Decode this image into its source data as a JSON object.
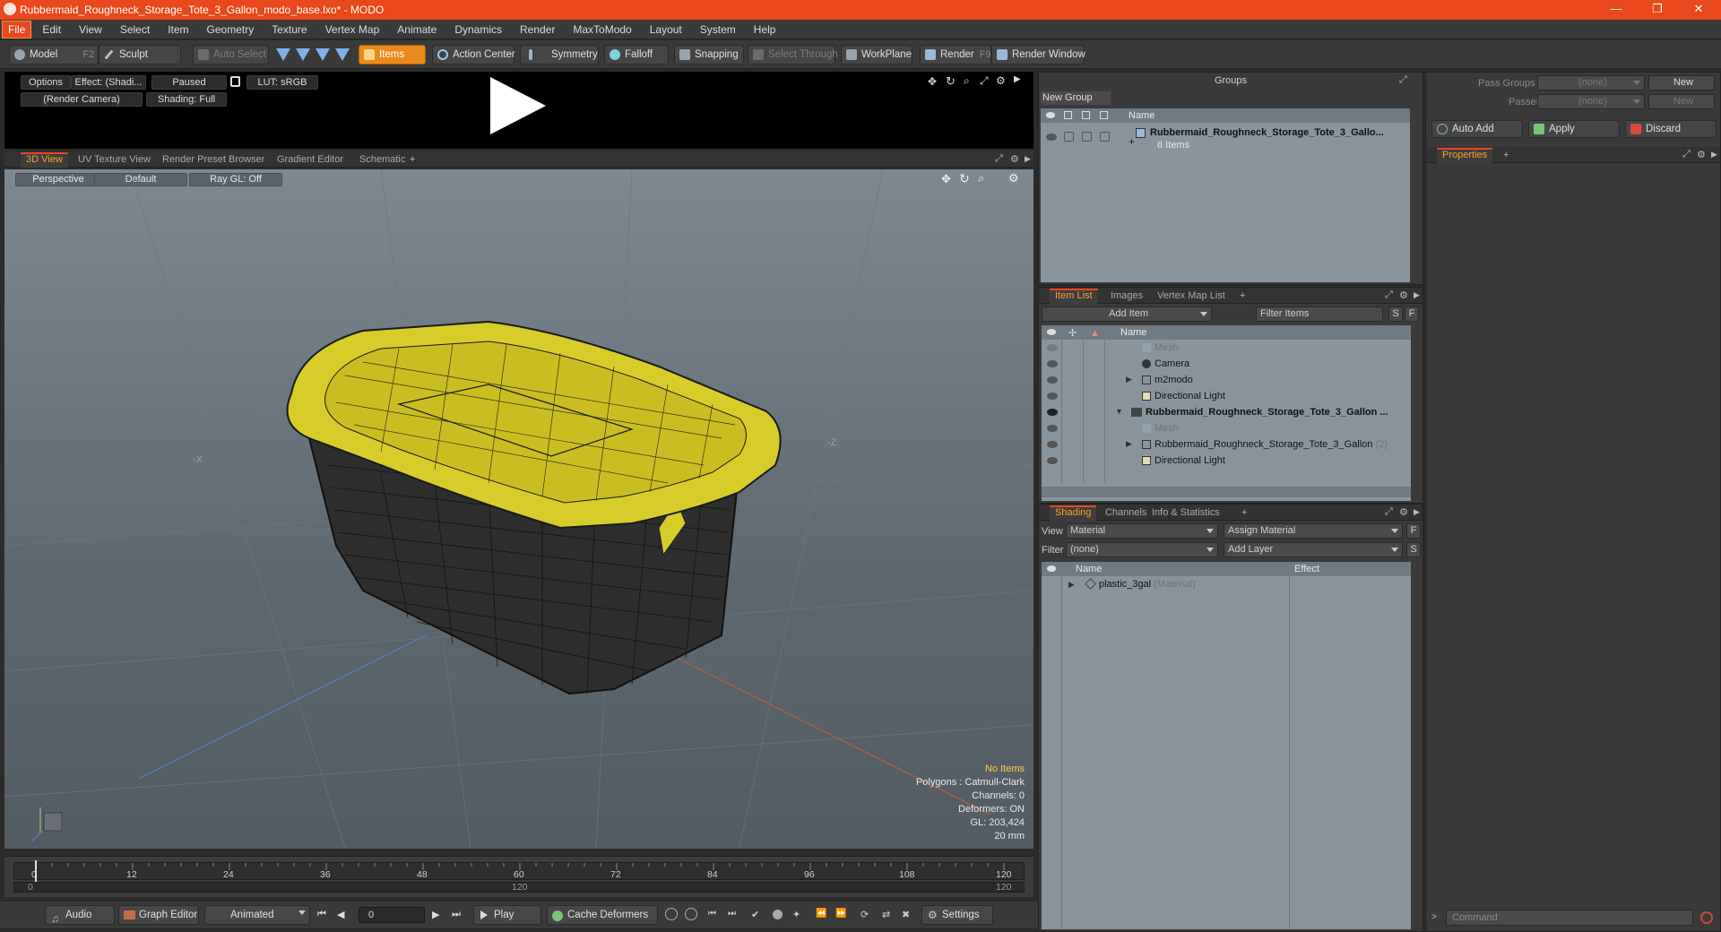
{
  "window": {
    "title": "Rubbermaid_Roughneck_Storage_Tote_3_Gallon_modo_base.lxo* - MODO",
    "minimize": "—",
    "restore": "❐",
    "close": "✕"
  },
  "menu": [
    "File",
    "Edit",
    "View",
    "Select",
    "Item",
    "Geometry",
    "Texture",
    "Vertex Map",
    "Animate",
    "Dynamics",
    "Render",
    "MaxToModo",
    "Layout",
    "System",
    "Help"
  ],
  "toolbar": {
    "model": "Model",
    "model_key": "F2",
    "sculpt": "Sculpt",
    "auto_select": "Auto Select",
    "items": "Items",
    "action_center": "Action Center",
    "symmetry": "Symmetry",
    "falloff": "Falloff",
    "snapping": "Snapping",
    "select_through": "Select Through",
    "workplane": "WorkPlane",
    "render": "Render",
    "render_key": "F9",
    "render_window": "Render Window"
  },
  "preview": {
    "options": "Options",
    "effect": "Effect: (Shadi...",
    "paused": "Paused",
    "lut": "LUT: sRGB",
    "camera": "(Render Camera)",
    "shading": "Shading: Full"
  },
  "viewport_tabs": [
    "3D View",
    "UV Texture View",
    "Render Preset Browser",
    "Gradient Editor",
    "Schematic"
  ],
  "viewport": {
    "perspective": "Perspective",
    "default": "Default",
    "raygl": "Ray GL: Off",
    "axis_x": "-X",
    "axis_z": "-Z",
    "stats": {
      "items": "No Items",
      "polygons": "Polygons : Catmull-Clark",
      "channels": "Channels: 0",
      "deformers": "Deformers: ON",
      "gl": "GL: 203,424",
      "unit": "20 mm"
    }
  },
  "timeline": {
    "ticks": [
      "0",
      "12",
      "24",
      "36",
      "48",
      "60",
      "72",
      "84",
      "96",
      "108",
      "120"
    ],
    "sub_start": "0",
    "sub_mid": "120",
    "sub_end": "120"
  },
  "transport": {
    "audio": "Audio",
    "graph_editor": "Graph Editor",
    "animated": "Animated",
    "frame": "0",
    "play": "Play",
    "cache": "Cache Deformers",
    "settings": "Settings"
  },
  "groups": {
    "title": "Groups",
    "new_group": "New Group",
    "col_name": "Name",
    "item_name": "Rubbermaid_Roughneck_Storage_Tote_3_Gallo...",
    "item_count": "6 Items"
  },
  "itemlist": {
    "tabs": [
      "Item List",
      "Images",
      "Vertex Map List"
    ],
    "add_item": "Add Item",
    "filter": "Filter Items",
    "s": "S",
    "f": "F",
    "col_name": "Name",
    "rows": [
      {
        "label": "Mesh",
        "dim": true
      },
      {
        "label": "Camera",
        "dim": false
      },
      {
        "label": "m2modo",
        "dim": false
      },
      {
        "label": "Directional Light",
        "dim": false
      },
      {
        "label": "Rubbermaid_Roughneck_Storage_Tote_3_Gallon ...",
        "dim": false
      },
      {
        "label": "Mesh",
        "dim": true
      },
      {
        "label": "Rubbermaid_Roughneck_Storage_Tote_3_Gallon",
        "dim": false
      },
      {
        "label": "Directional Light",
        "dim": false
      }
    ],
    "row_suffix": "(2)"
  },
  "shading": {
    "tabs": [
      "Shading",
      "Channels",
      "Info & Statistics"
    ],
    "view_label": "View",
    "view_value": "Material",
    "assign": "Assign Material",
    "filter_label": "Filter",
    "filter_value": "(none)",
    "add_layer": "Add Layer",
    "col_name": "Name",
    "col_effect": "Effect",
    "material": "plastic_3gal",
    "material_type": "(Material)"
  },
  "props": {
    "pass_groups": "Pass Groups",
    "passes": "Passes",
    "none": "(none)",
    "new": "New",
    "auto_add": "Auto Add",
    "apply": "Apply",
    "discard": "Discard",
    "properties": "Properties",
    "command": "Command"
  },
  "colors": {
    "accent": "#e8481b",
    "orange_tab": "#ff9c2a",
    "lid": "#d8cc2a",
    "body": "#2e2e2e"
  }
}
